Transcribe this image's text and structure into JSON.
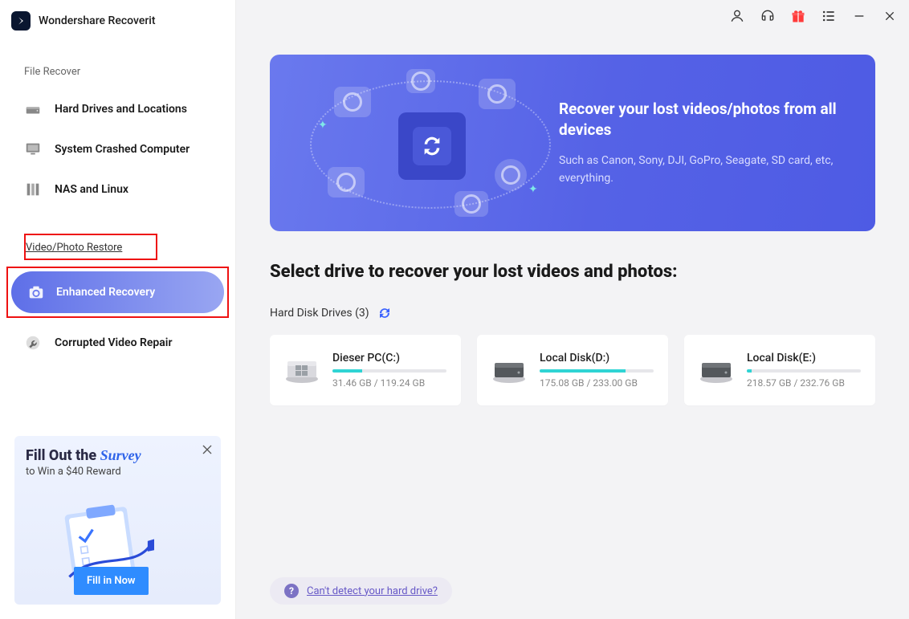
{
  "app_title": "Wondershare Recoverit",
  "sidebar": {
    "section1_label": "File Recover",
    "items": [
      {
        "label": "Hard Drives and Locations",
        "icon": "hard-drive-icon"
      },
      {
        "label": "System Crashed Computer",
        "icon": "monitor-icon"
      },
      {
        "label": "NAS and Linux",
        "icon": "server-icon"
      }
    ],
    "section2_label": "Video/Photo Restore",
    "enhanced_label": "Enhanced Recovery",
    "corrupted_label": "Corrupted Video Repair"
  },
  "promo": {
    "title_pre": "Fill Out the ",
    "title_bold": "Survey",
    "subtitle": "to Win a $40 Reward",
    "button": "Fill in Now"
  },
  "banner": {
    "title": "Recover your lost videos/photos from all devices",
    "subtitle": "Such as Canon, Sony, DJI, GoPro, Seagate, SD card, etc, everything."
  },
  "select_title": "Select drive to recover your lost videos and photos:",
  "hdd_label": "Hard Disk Drives (3)",
  "drives": [
    {
      "name": "Dieser PC(C:)",
      "used": "31.46 GB",
      "total": "119.24 GB",
      "pct": 26,
      "type": "windows"
    },
    {
      "name": "Local Disk(D:)",
      "used": "175.08 GB",
      "total": "233.00 GB",
      "pct": 75,
      "type": "disk"
    },
    {
      "name": "Local Disk(E:)",
      "used": "218.57 GB",
      "total": "232.76 GB",
      "pct": 4,
      "type": "disk"
    }
  ],
  "help_link": "Can't detect your hard drive?"
}
